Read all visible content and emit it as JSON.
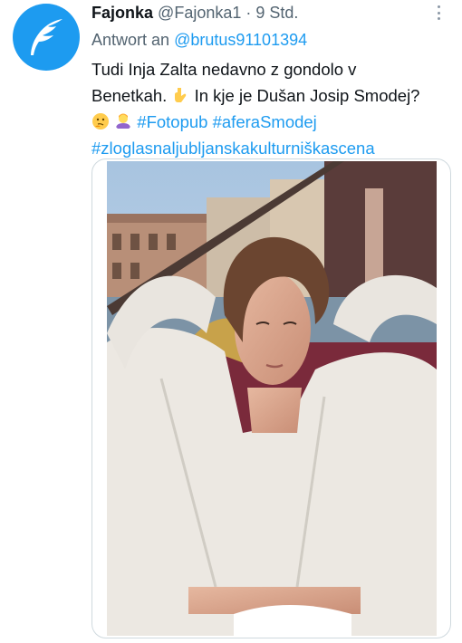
{
  "tweet": {
    "author": {
      "name": "Fajonka",
      "handle": "@Fajonka1",
      "avatar_icon": "feather-icon",
      "avatar_color": "#1d9bf0"
    },
    "separator": "·",
    "time": "9 Std.",
    "reply_prefix": "Antwort an",
    "reply_to": "@brutus91101394",
    "text_line1": "Tudi Inja Zalta nedavno z gondolo v",
    "text_line2_a": "Benetkah.",
    "text_line2_b": "In kje je Dušan Josip Smodej?",
    "emoji": [
      "pointing-down-emoji",
      "thinking-face-emoji",
      "woman-shrugging-emoji"
    ],
    "hashtag_fotopub": "#Fotopub",
    "hashtag_afera": "#aferaSmodej",
    "hashtag_long": "#zloglasnaljubljanskakulturniškascena",
    "more_icon": "more-vertical-icon",
    "colors": {
      "accent": "#1d9bf0",
      "text": "#0f1419",
      "secondary": "#536471",
      "border": "#cfd9de"
    }
  }
}
